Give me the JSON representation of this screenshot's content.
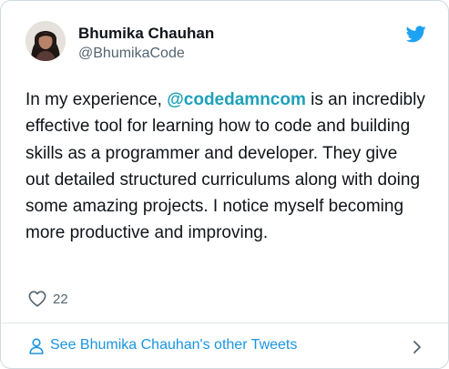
{
  "author": {
    "name": "Bhumika Chauhan",
    "handle": "@BhumikaCode"
  },
  "tweet": {
    "text_before": "In my experience, ",
    "mention": "@codedamncom",
    "text_after": " is an incredibly effective tool for learning how to code and building skills as a programmer and developer. They give out detailed structured curriculums along with doing some amazing projects. I notice myself becoming more productive and improving."
  },
  "stats": {
    "likes": "22"
  },
  "footer": {
    "link_label": "See Bhumika Chauhan's other Tweets"
  },
  "icons": {
    "logo": "twitter-bird-icon",
    "like": "heart-icon",
    "person": "person-icon",
    "chevron": "chevron-right-icon"
  },
  "colors": {
    "brand_blue": "#1da1f2",
    "mention_teal": "#1da1b8",
    "link_blue": "#1b95e0",
    "text_primary": "#0f1419",
    "text_secondary": "#536471"
  }
}
